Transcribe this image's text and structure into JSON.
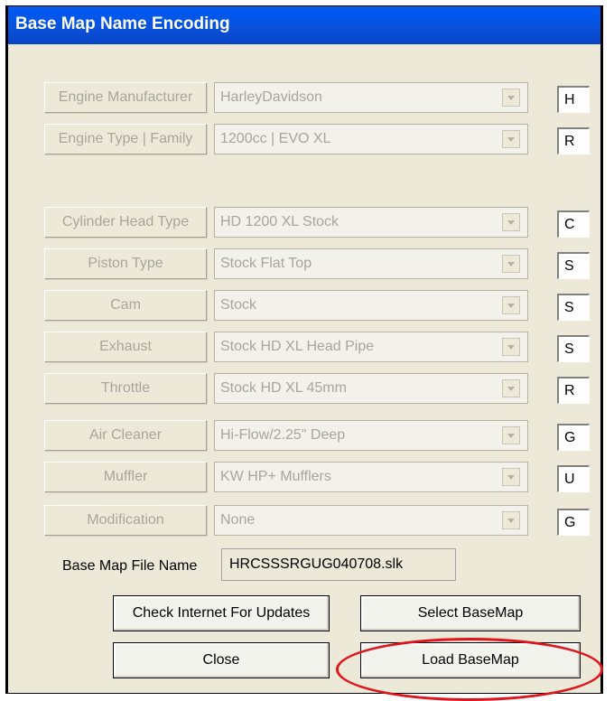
{
  "window": {
    "title": "Base Map Name Encoding"
  },
  "rows": [
    {
      "label": "Engine Manufacturer",
      "value": "HarleyDavidson",
      "code": "H"
    },
    {
      "label": "Engine Type | Family",
      "value": "1200cc | EVO XL",
      "code": "R"
    },
    {
      "label": "Cylinder Head Type",
      "value": "HD 1200 XL Stock",
      "code": "C"
    },
    {
      "label": "Piston Type",
      "value": "Stock Flat Top",
      "code": "S"
    },
    {
      "label": "Cam",
      "value": "Stock",
      "code": "S"
    },
    {
      "label": "Exhaust",
      "value": "Stock HD XL Head Pipe",
      "code": "S"
    },
    {
      "label": "Throttle",
      "value": "Stock HD XL 45mm",
      "code": "R"
    },
    {
      "label": "Air Cleaner",
      "value": "Hi-Flow/2.25\" Deep",
      "code": "G"
    },
    {
      "label": "Muffler",
      "value": "KW HP+ Mufflers",
      "code": "U"
    },
    {
      "label": "Modification",
      "value": "None",
      "code": "G"
    }
  ],
  "file": {
    "label": "Base Map File Name",
    "value": "HRCSSSRGUG040708.slk"
  },
  "buttons": {
    "check_updates": "Check Internet For Updates",
    "select_basemap": "Select BaseMap",
    "close": "Close",
    "load_basemap": "Load BaseMap"
  },
  "colors": {
    "title_bar": "#0a50d8",
    "highlight": "#e0141c",
    "window_bg": "#ece9d8"
  }
}
